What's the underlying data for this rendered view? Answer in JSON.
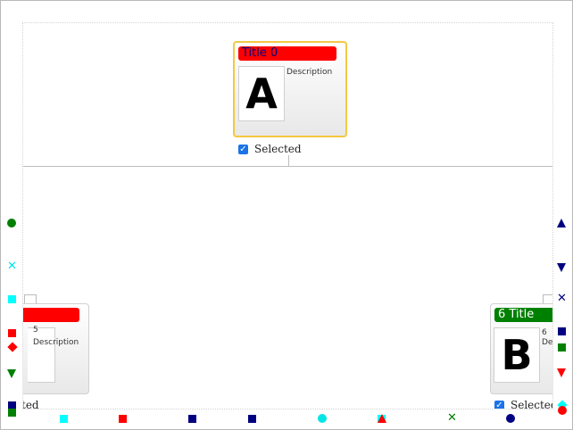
{
  "cards": [
    {
      "title": "Title 0",
      "title_color": "#ff0000",
      "letter": "A",
      "description": "Description",
      "number": "",
      "checkbox_label": "Selected"
    },
    {
      "title": "",
      "title_color": "#ff0000",
      "letter": "",
      "description": "Description",
      "number": "5",
      "checkbox_label": "ted"
    },
    {
      "title": "6 Title",
      "title_color": "#008000",
      "letter": "B",
      "description": "Des",
      "number": "6",
      "checkbox_label": "Selected"
    }
  ],
  "colors": {
    "selected_border": "#f5c842",
    "checkbox": "#1a73e8",
    "markers": [
      "#008000",
      "#00ffff",
      "#ff0000",
      "#000080"
    ]
  }
}
